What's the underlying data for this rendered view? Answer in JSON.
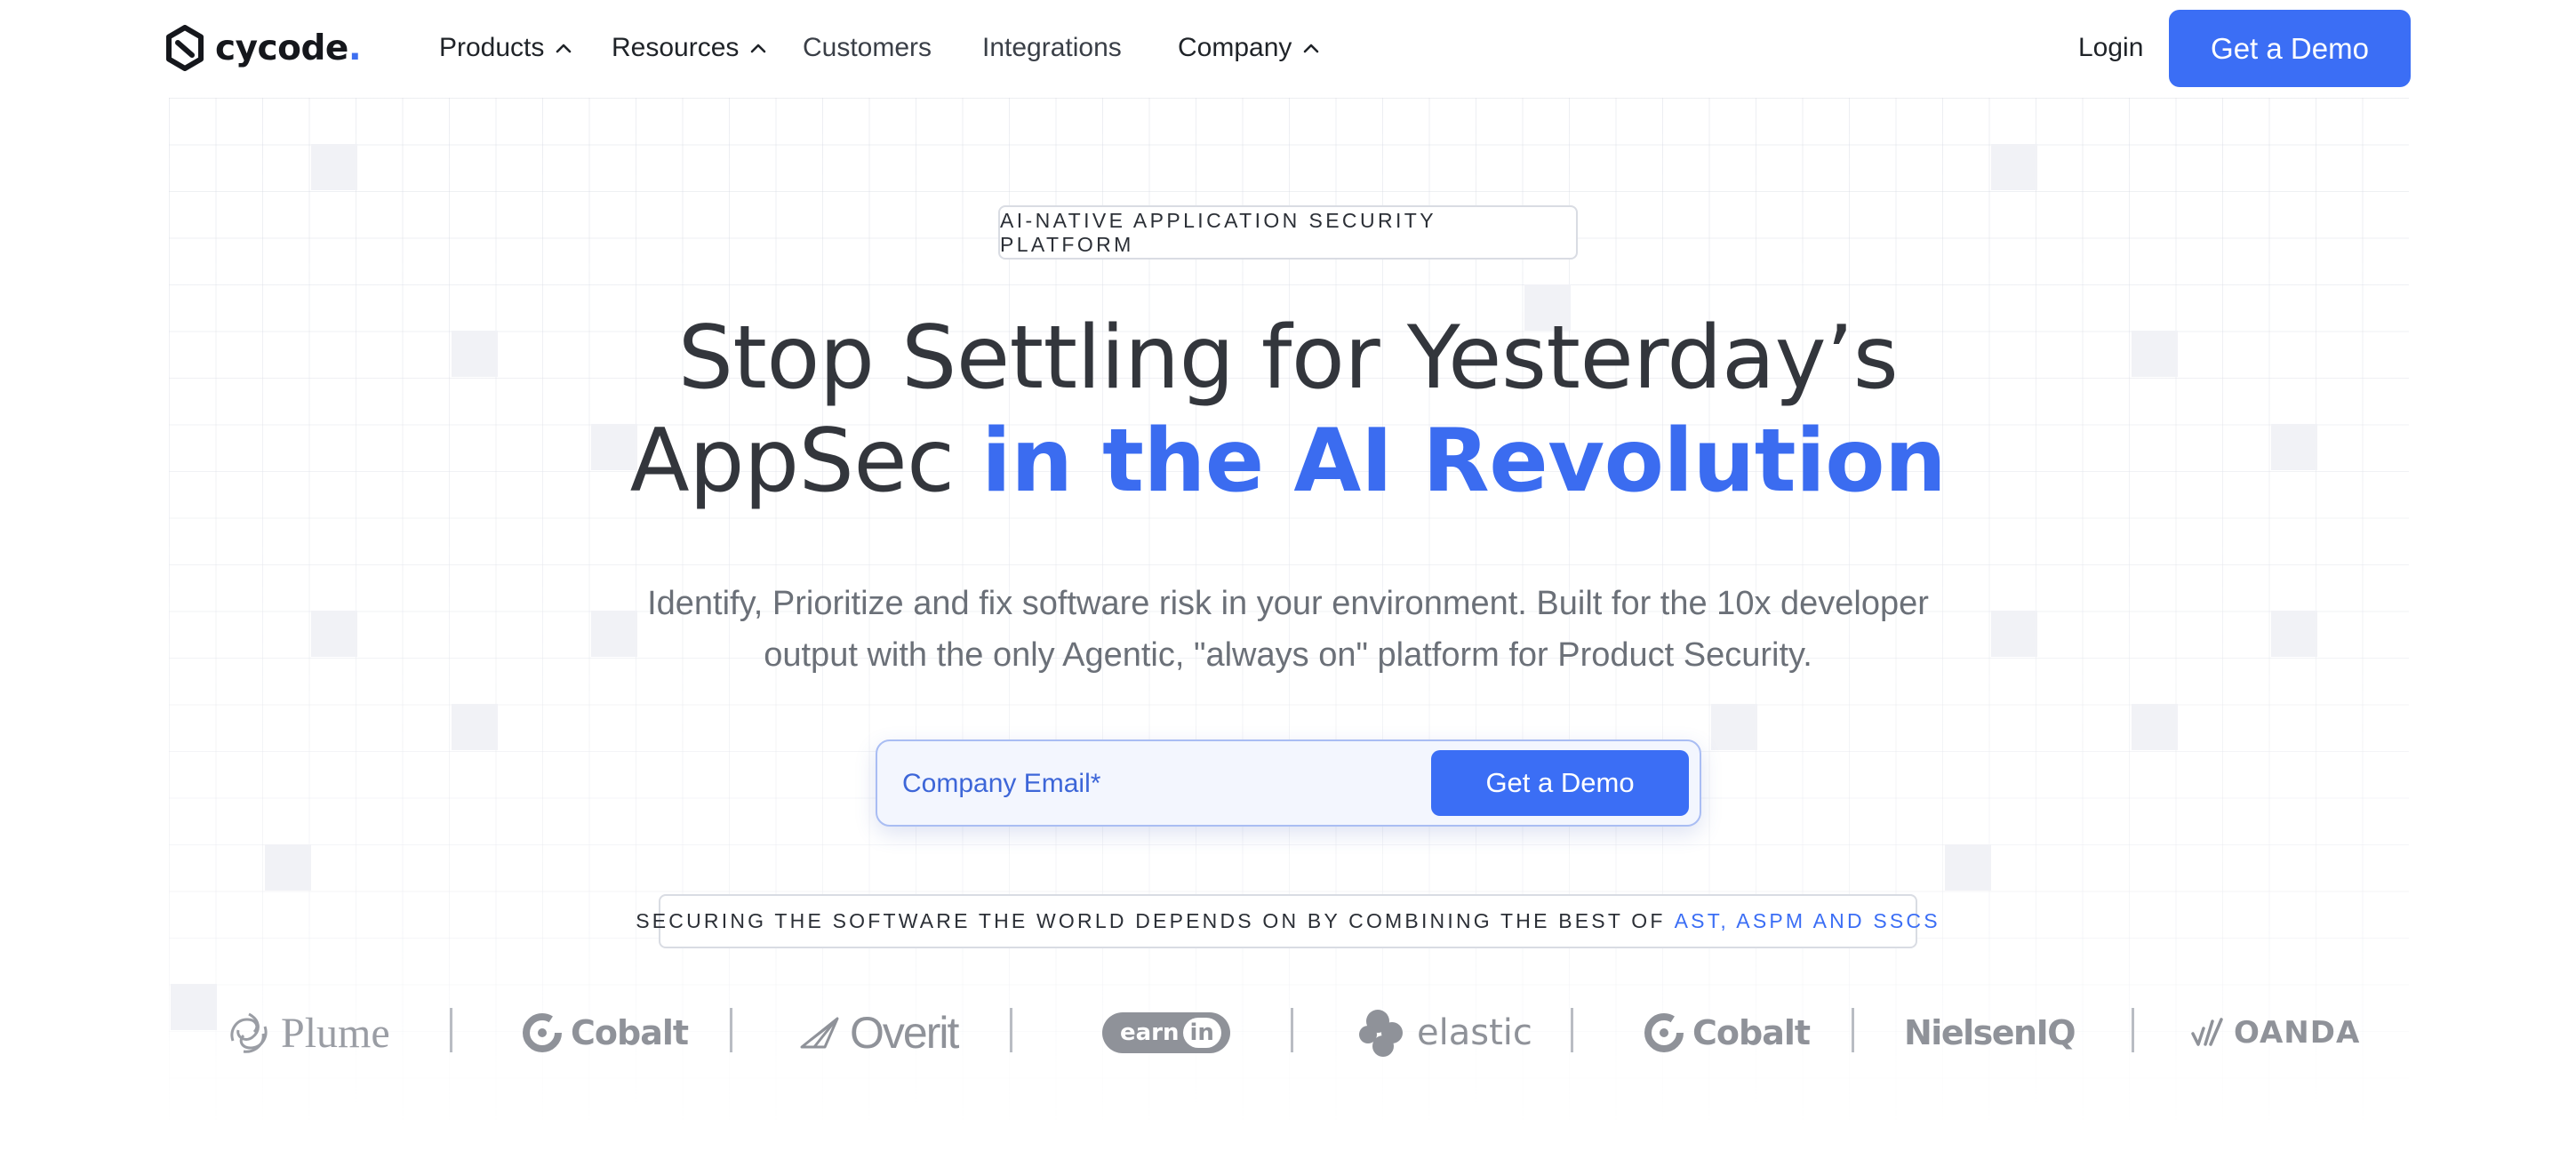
{
  "brand": {
    "name": "cycode",
    "dot": "."
  },
  "nav": {
    "items": [
      {
        "label": "Products",
        "has_dropdown": true
      },
      {
        "label": "Resources",
        "has_dropdown": true
      },
      {
        "label": "Customers",
        "has_dropdown": false
      },
      {
        "label": "Integrations",
        "has_dropdown": false
      },
      {
        "label": "Company",
        "has_dropdown": true
      }
    ],
    "login": "Login",
    "cta": "Get a Demo"
  },
  "hero": {
    "eyebrow": "AI-NATIVE APPLICATION SECURITY PLATFORM",
    "headline_line1": "Stop Settling for Yesterday’s",
    "headline_line2_plain": "AppSec",
    "headline_line2_accent": "in the AI Revolution",
    "subtitle_line1": "Identify, Prioritize and fix software risk in your environment. Built for the 10x developer",
    "subtitle_line2": "output with the only Agentic, \"always on\" platform for Product Security.",
    "email_placeholder": "Company Email*",
    "form_cta": "Get a Demo",
    "tagline_prefix": "SECURING THE SOFTWARE THE WORLD DEPENDS ON BY COMBINING THE BEST OF",
    "tagline_accent": "AST, ASPM AND SSCS"
  },
  "customers": [
    {
      "name": "Plume",
      "icon": "plume-logo"
    },
    {
      "name": "Cobalt",
      "icon": "cobalt-logo"
    },
    {
      "name": "Overit",
      "icon": "overit-logo"
    },
    {
      "name_part1": "earn",
      "name_part2": "in",
      "icon": "earnin-logo"
    },
    {
      "name": "elastic",
      "icon": "elastic-logo"
    },
    {
      "name": "Cobalt",
      "icon": "cobalt-logo"
    },
    {
      "name": "NielsenIQ",
      "icon": "nielseniq-logo"
    },
    {
      "name": "OANDA",
      "icon": "oanda-logo"
    }
  ],
  "colors": {
    "accent": "#3b6ef5",
    "headline_accent": "#3b6cf0",
    "text_dark": "#33363c",
    "text_muted": "#6b7078",
    "logo_gray": "#8f9299"
  }
}
